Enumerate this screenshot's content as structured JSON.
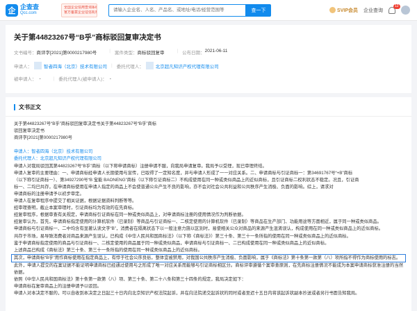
{
  "topbar": {
    "logo_mark": "企",
    "logo_name": "企查查",
    "logo_domain": "Qcc.com",
    "badge_lines": [
      "全国企业信用查询系统",
      "官方备案企业征信机构"
    ],
    "search_placeholder": "请输入企业名、人名、产品名、或地址/电话/经营范围等",
    "search_button": "查一下",
    "svip_label": "SVIP会员",
    "workspace_label": "企业查询",
    "bell_count": "12",
    "colors": {
      "brand": "#128bed",
      "accent": "#f04134",
      "svip": "#c7892e"
    }
  },
  "header": {
    "title": "关于第44823267号“B乎”商标驳回复审决定书",
    "doc_no_label": "文书编号：",
    "doc_no": "商评字[2021]第0000217980号",
    "type_label": "案件类型：",
    "type": "商标驳回复审",
    "date_label": "公布日期：",
    "date": "2021-06-11",
    "applicant_label": "申请人：",
    "applicant": "智者四海（北京）技术有限公司",
    "agent_label": "委托代理人：",
    "agent": "北京超凡知识产权代理有限公司",
    "respondent_label": "被申请人：",
    "respondent": "-",
    "respondent_agent_label": "委托代理人(被申请人)：",
    "respondent_agent": "-"
  },
  "body": {
    "section_title": "文书正文",
    "paragraphs": [
      "关于第44823267号“B乎”商标驳回复审决定书关于第44823267号“B乎”商标",
      "驳回复审决定书",
      "商评字[2021]第0000217980号",
      "",
      "申请人：智者四海（北京）技术有限公司",
      "委托代理人：北京超凡知识产权代理有限公司",
      "申请人对我局驳回其第44823267号“B乎”商标（以下称申请商标）注册申请不服，向我局申请复审。我局予以受理，现已审理终结。",
      "申请人复审的主要理由：一、申请商标经申请人长期使用与宣传，已取得了一定知名度，并与申请人形成了一一对应关系。二、申请商标与引证商标一：第34691767号“+B”商标",
      "（以下称引证商标一）、第34927290号“B 宝能 BAONENG”商标（以下称引证商标二）不构成使用在同一种或类似商品上的近似商标，且引证商标二权利状态不稳定。况且，引证商",
      "标一、二均已共存，在申请商标使用在申请人指定的商品上不会使普通公众产生不良的影响，亦不会对社会公共利益和公共秩序产生消极、负面的影响。综上，请求对",
      "申请商标的注册申请予以初步审定。",
      "申请人在复审程序中提交了相关证据，根据证据资料判断等等。",
      "经审理查明，截止本案审理时，引证商标均为有效的在先商标。",
      "经复审程序，根据审查有关规定，申请商标引证商标在同一种或类似商品上，对申请商标注册的使用情况作为判断依据。",
      "经复审认为，首先，申请商标指定使用的计算机软件（已录制）等商品与引证商标一、二核定使用的计算机软件（已录制）等商品在生产部门、功能用途等方面相近，属于同一种或类似商品。",
      "申请商标与引证商标一、二中均含有显著认读文字“B”，消费者在隔离状态下以一般注意力施以区别时，易使相关公众对商品的来源产生混淆误认，构成使用在同一种或类似商品上的近似商标。",
      "共存于市场，易导致消费者对商品来源产生误认，已构成《中华人民共和国商标法》（以下称《商标法》）第三十条、第三十一条所指的使用在同一种或类似商品上的近似商标。",
      "鉴于申请商标指定使用的商品与引证商标一、二核定使用的商品属于同一种或类似商品，申请商标与引证商标一、二已构成使用在同一种或类似商品上的近似商标。",
      "上述商品已构成《商标法》第三十条、第三十一条所指的使用在同一种或类似商品上的近似商标。",
      "其次，申请商标“B乎”用作商标使用在指定商品上，有悖于社会公序良俗，整体宜被禁用，对我国公共秩序产生消极、负面影响，属于《商标法》第十条第一款第（八）项所指不得作为商标使用的标志。",
      "此外，申请人提交的在案证据不能证明申请商标已经通过使用与之形成了唯一对应关系而能够与引证商标相区分。商标评审遵循个案审查原则，在先商标注册情况不能成为本案申请商标获准注册的当然依据。",
      "依照《中华人民共和国商标法》第十条第一款第（八）项、第三十条、第二十八条和第三十四条的规定，我局决定如下：",
      "申请商标在复审商品上的注册申请予以驳回。",
      "申请人对本决定不服的，可以自收到本决定之日起三十日内向北京知识产权法院起诉，并在向法院递交起诉状的同时或者至迟十五日内将该起诉状副本抄送或者另行书面告知我局。"
    ]
  }
}
